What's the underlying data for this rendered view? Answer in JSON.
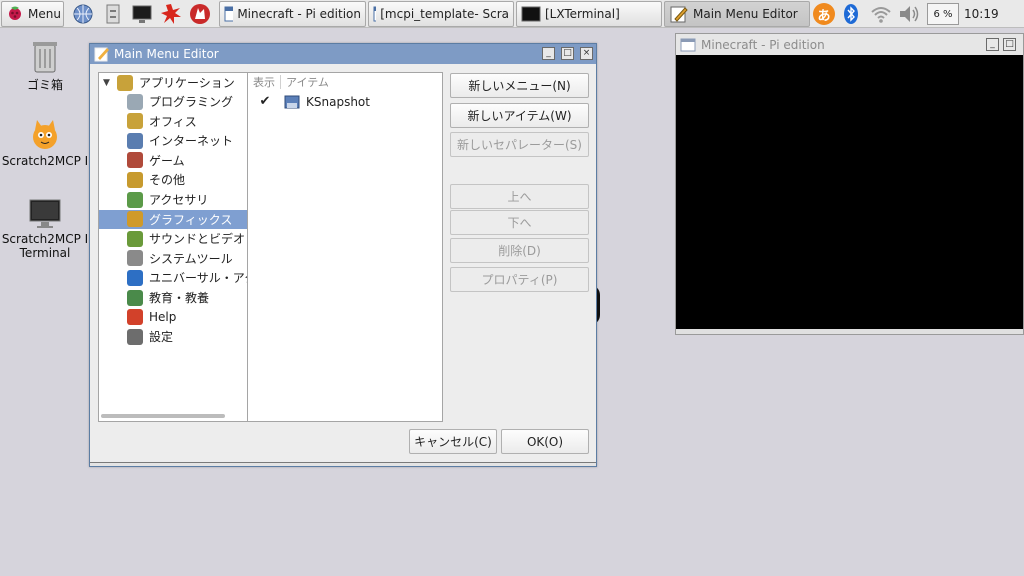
{
  "taskbar": {
    "menu_label": "Menu",
    "tasks": [
      {
        "label": "Minecraft - Pi edition"
      },
      {
        "label": "[mcpi_template- Scra"
      },
      {
        "label": "[LXTerminal]"
      },
      {
        "label": "Main Menu Editor"
      }
    ],
    "ime_label": "あ",
    "cpu_label": "6 %",
    "clock": "10:19"
  },
  "desktop": {
    "icons": [
      {
        "label": "ゴミ箱"
      },
      {
        "label": "Scratch2MCP I"
      },
      {
        "label": "Scratch2MCP I Terminal"
      }
    ]
  },
  "editor": {
    "title": "Main Menu Editor",
    "tree": {
      "root": "アプリケーション",
      "items": [
        {
          "label": "プログラミング",
          "icon": "programming-icon",
          "color": "#9aa8b4"
        },
        {
          "label": "オフィス",
          "icon": "office-icon",
          "color": "#c8a23a"
        },
        {
          "label": "インターネット",
          "icon": "internet-icon",
          "color": "#5a7db0"
        },
        {
          "label": "ゲーム",
          "icon": "games-icon",
          "color": "#b04a3a"
        },
        {
          "label": "その他",
          "icon": "other-icon",
          "color": "#c79a2e"
        },
        {
          "label": "アクセサリ",
          "icon": "accessories-icon",
          "color": "#5b9a48"
        },
        {
          "label": "グラフィックス",
          "icon": "graphics-icon",
          "color": "#d09a2a"
        },
        {
          "label": "サウンドとビデオ",
          "icon": "sound-video-icon",
          "color": "#6a9a3a"
        },
        {
          "label": "システムツール",
          "icon": "system-tools-icon",
          "color": "#8a8a8a"
        },
        {
          "label": "ユニバーサル・アクセス",
          "icon": "universal-access-icon",
          "color": "#2d6fc4"
        },
        {
          "label": "教育・教養",
          "icon": "education-icon",
          "color": "#4a8a4a"
        },
        {
          "label": "Help",
          "icon": "help-icon",
          "color": "#d2412a"
        },
        {
          "label": "設定",
          "icon": "settings-icon",
          "color": "#6d6d6d"
        }
      ],
      "selected_index": 6
    },
    "items_pane": {
      "header_show": "表示",
      "header_item": "アイテム",
      "rows": [
        {
          "checked": true,
          "label": "KSnapshot"
        }
      ]
    },
    "buttons": {
      "new_menu": "新しいメニュー(N)",
      "new_item": "新しいアイテム(W)",
      "new_separator": "新しいセパレーター(S)",
      "move_up": "上へ",
      "move_down": "下へ",
      "delete": "削除(D)",
      "properties": "プロパティ(P)",
      "cancel": "キャンセル(C)",
      "ok": "OK(O)"
    }
  },
  "minecraft": {
    "title": "Minecraft - Pi edition"
  }
}
